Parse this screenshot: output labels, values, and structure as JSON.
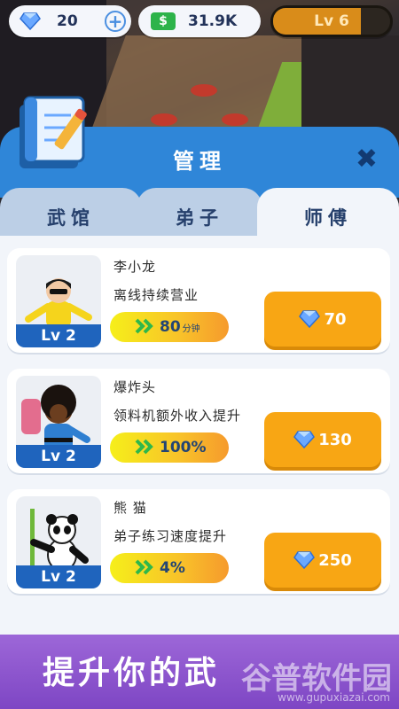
{
  "hud": {
    "gems_value": "20",
    "plus_label": "+",
    "cash_symbol": "$",
    "cash_value": "31.9K",
    "level_label": "Lv 6",
    "level_progress": 0.75
  },
  "panel": {
    "title": "管理",
    "close_label": "✖"
  },
  "tabs": [
    {
      "label": "武馆",
      "active": false
    },
    {
      "label": "弟子",
      "active": false
    },
    {
      "label": "师傅",
      "active": true
    }
  ],
  "masters": [
    {
      "name": "李小龙",
      "level": "Lv 2",
      "desc": "离线持续营业",
      "stat": "80",
      "stat_unit": "分钟",
      "price": "70"
    },
    {
      "name": "爆炸头",
      "level": "Lv 2",
      "desc": "领料机额外收入提升",
      "stat": "100%",
      "stat_unit": "",
      "price": "130"
    },
    {
      "name": "熊 猫",
      "level": "Lv 2",
      "desc": "弟子练习速度提升",
      "stat": "4%",
      "stat_unit": "",
      "price": "250"
    }
  ],
  "footer": {
    "text": "提升你的武",
    "watermark": "谷普软件园",
    "watermark_url": "www.gupuxiazai.com"
  },
  "colors": {
    "panel_blue": "#2f86d8",
    "buy_orange": "#f8a614",
    "level_badge": "#1f64bd",
    "footer_purple": "#8a52cc"
  }
}
